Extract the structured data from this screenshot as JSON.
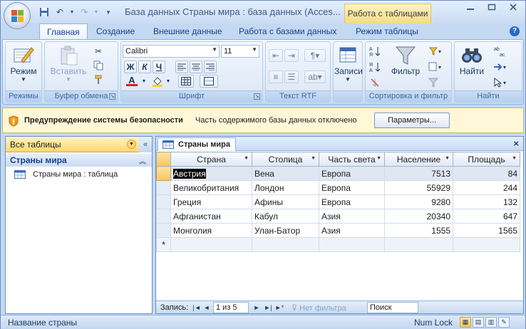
{
  "window": {
    "title": "База данных Страны мира : база данных (Acces...",
    "context_tab_title": "Работа с таблицами"
  },
  "ribbon_tabs": [
    {
      "label": "Главная",
      "active": true
    },
    {
      "label": "Создание",
      "active": false
    },
    {
      "label": "Внешние данные",
      "active": false
    },
    {
      "label": "Работа с базами данных",
      "active": false
    },
    {
      "label": "Режим таблицы",
      "active": false
    }
  ],
  "ribbon": {
    "groups": {
      "views": "Режимы",
      "clipboard": "Буфер обмена",
      "font": "Шрифт",
      "rtf": "Текст RTF",
      "records": "",
      "sort_filter": "Сортировка и фильтр",
      "find": "Найти"
    },
    "buttons": {
      "view": "Режим",
      "paste": "Вставить",
      "records": "Записи",
      "filter": "Фильтр",
      "find": "Найти"
    },
    "font_name": "Calibri",
    "font_size": "11",
    "bold": "Ж",
    "italic": "К",
    "underline": "Ч",
    "font_color_letter": "A"
  },
  "security_bar": {
    "title": "Предупреждение системы безопасности",
    "message": "Часть содержимого базы данных отключено",
    "button": "Параметры..."
  },
  "nav_pane": {
    "header": "Все таблицы",
    "group": "Страны мира",
    "items": [
      "Страны мира : таблица"
    ]
  },
  "document": {
    "tab_label": "Страны мира",
    "columns": [
      "Страна",
      "Столица",
      "Часть света",
      "Население",
      "Площадь"
    ],
    "rows": [
      [
        "Австрия",
        "Вена",
        "Европа",
        "7513",
        "84"
      ],
      [
        "Великобритания",
        "Лондон",
        "Европа",
        "55929",
        "244"
      ],
      [
        "Греция",
        "Афины",
        "Европа",
        "9280",
        "132"
      ],
      [
        "Афганистан",
        "Кабул",
        "Азия",
        "20340",
        "647"
      ],
      [
        "Монголия",
        "Улан-Батор",
        "Азия",
        "1555",
        "1565"
      ]
    ],
    "new_row_marker": "*"
  },
  "record_nav": {
    "label": "Запись:",
    "current": "1 из 5",
    "no_filter": "Нет фильтра",
    "search_placeholder": "Поиск"
  },
  "status_bar": {
    "text": "Название страны",
    "num_lock": "Num Lock"
  }
}
